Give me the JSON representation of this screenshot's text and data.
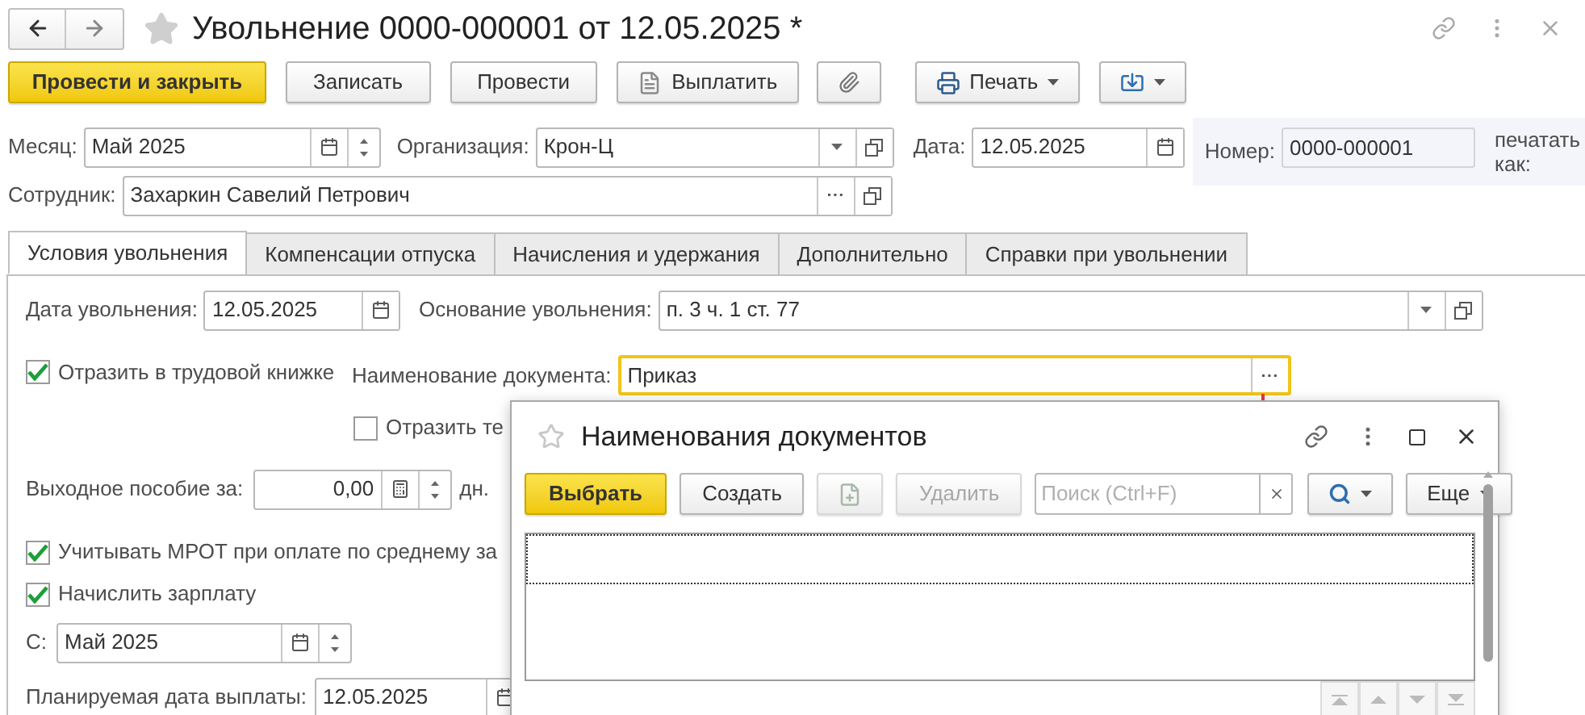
{
  "window": {
    "title": "Увольнение 0000-000001 от 12.05.2025 *"
  },
  "toolbar": [
    {
      "kind": "primary",
      "label": "Провести и закрыть"
    },
    {
      "kind": "plain",
      "label": "Записать"
    },
    {
      "kind": "plain",
      "label": "Провести"
    },
    {
      "kind": "pay",
      "label": "Выплатить"
    },
    {
      "kind": "attach"
    },
    {
      "kind": "print",
      "label": "Печать"
    },
    {
      "kind": "import"
    }
  ],
  "header": {
    "month": {
      "label": "Месяц:",
      "value": "Май 2025"
    },
    "organization": {
      "label": "Организация:",
      "value": "Крон-Ц"
    },
    "date": {
      "label": "Дата:",
      "value": "12.05.2025"
    },
    "number": {
      "label": "Номер:",
      "value": "0000-000001"
    },
    "print_as": "печатать как:",
    "employee": {
      "label": "Сотрудник:",
      "value": "Захаркин Савелий Петрович"
    }
  },
  "tabs": [
    {
      "label": "Условия увольнения",
      "selected": true
    },
    {
      "label": "Компенсации отпуска",
      "selected": false
    },
    {
      "label": "Начисления и удержания",
      "selected": false
    },
    {
      "label": "Дополнительно",
      "selected": false
    },
    {
      "label": "Справки при увольнении",
      "selected": false
    }
  ],
  "conditions": {
    "dismissal_date": {
      "label": "Дата увольнения:",
      "value": "12.05.2025"
    },
    "basis": {
      "label": "Основание увольнения:",
      "value": "п. 3 ч. 1 ст. 77"
    },
    "workbook": {
      "label": "Отразить в трудовой книжке",
      "checked": true
    },
    "document_name": {
      "label": "Наименование документа:",
      "value": "Приказ",
      "focused": true
    },
    "reflect": {
      "label": "Отразить те",
      "checked": false
    },
    "severance": {
      "label": "Выходное пособие за:",
      "value": "0,00",
      "unit": "дн."
    },
    "mrot": {
      "label": "Учитывать МРОТ при оплате по среднему за",
      "checked": true
    },
    "accrue": {
      "label": "Начислить зарплату",
      "checked": true
    },
    "from": {
      "label": "С:",
      "value": "Май 2025"
    },
    "planned": {
      "label": "Планируемая дата выплаты:",
      "value": "12.05.2025"
    }
  },
  "dialog": {
    "title": "Наименования документов",
    "buttons": [
      {
        "kind": "primary",
        "label": "Выбрать",
        "disabled": false
      },
      {
        "kind": "plain",
        "label": "Создать",
        "disabled": false
      },
      {
        "kind": "add",
        "disabled": true
      },
      {
        "kind": "plain",
        "label": "Удалить",
        "disabled": true
      }
    ],
    "search": {
      "placeholder": "Поиск (Ctrl+F)"
    },
    "more": "Еще"
  }
}
